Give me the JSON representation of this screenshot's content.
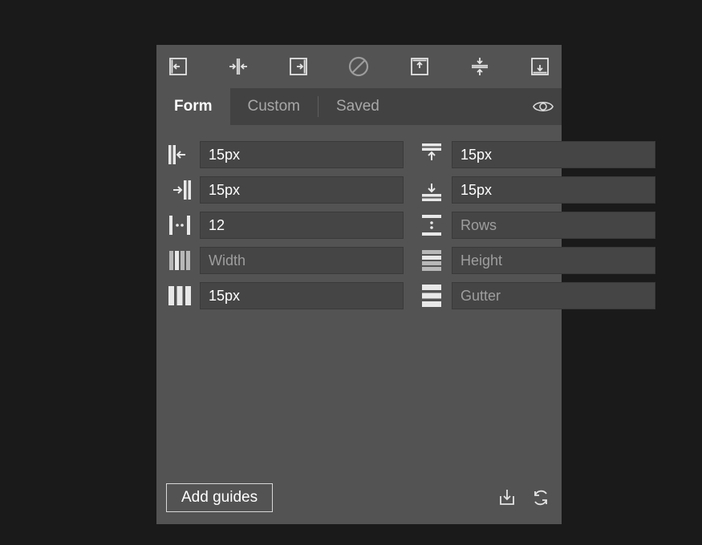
{
  "tabs": {
    "form": "Form",
    "custom": "Custom",
    "saved": "Saved",
    "active": "form"
  },
  "fields": {
    "margin_left": {
      "value": "15px",
      "placeholder": ""
    },
    "margin_top": {
      "value": "15px",
      "placeholder": ""
    },
    "margin_right": {
      "value": "15px",
      "placeholder": ""
    },
    "margin_bottom": {
      "value": "15px",
      "placeholder": ""
    },
    "columns": {
      "value": "12",
      "placeholder": ""
    },
    "rows": {
      "value": "",
      "placeholder": "Rows"
    },
    "col_width": {
      "value": "",
      "placeholder": "Width"
    },
    "row_height": {
      "value": "",
      "placeholder": "Height"
    },
    "col_gutter": {
      "value": "15px",
      "placeholder": ""
    },
    "row_gutter": {
      "value": "",
      "placeholder": "Gutter"
    }
  },
  "footer": {
    "add_guides": "Add guides"
  }
}
